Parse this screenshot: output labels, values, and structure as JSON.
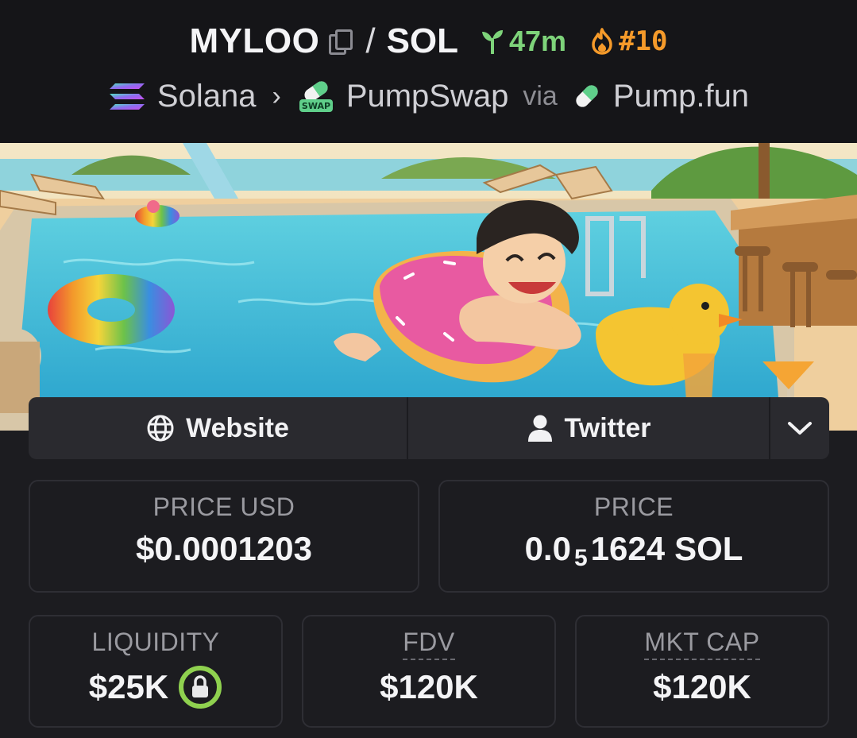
{
  "header": {
    "base_symbol": "MYLOO",
    "separator": "/",
    "quote_symbol": "SOL",
    "age": "47m",
    "trending_rank": "#10"
  },
  "breadcrumb": {
    "chain": "Solana",
    "dex": "PumpSwap",
    "via_label": "via",
    "launchpad": "Pump.fun",
    "swap_badge": "SWAP"
  },
  "links": {
    "website_label": "Website",
    "twitter_label": "Twitter"
  },
  "stats": {
    "price_usd": {
      "label": "PRICE USD",
      "value": "$0.0001203"
    },
    "price_native": {
      "label": "PRICE",
      "prefix": "0.0",
      "zeros": "5",
      "digits": "1624",
      "unit": "SOL"
    },
    "liquidity": {
      "label": "LIQUIDITY",
      "value": "$25K"
    },
    "fdv": {
      "label": "FDV",
      "value": "$120K"
    },
    "mkt_cap": {
      "label": "MKT CAP",
      "value": "$120K"
    }
  },
  "colors": {
    "background": "#1c1c20",
    "header_bg": "#151518",
    "age_green": "#7ed37a",
    "trend_orange": "#f59a2a",
    "lock_green": "#8fd14f"
  },
  "icons": [
    "copy-icon",
    "seedling-icon",
    "flame-icon",
    "solana-icon",
    "pumpswap-icon",
    "pill-icon",
    "globe-icon",
    "user-icon",
    "chevron-down-icon",
    "lock-icon"
  ]
}
